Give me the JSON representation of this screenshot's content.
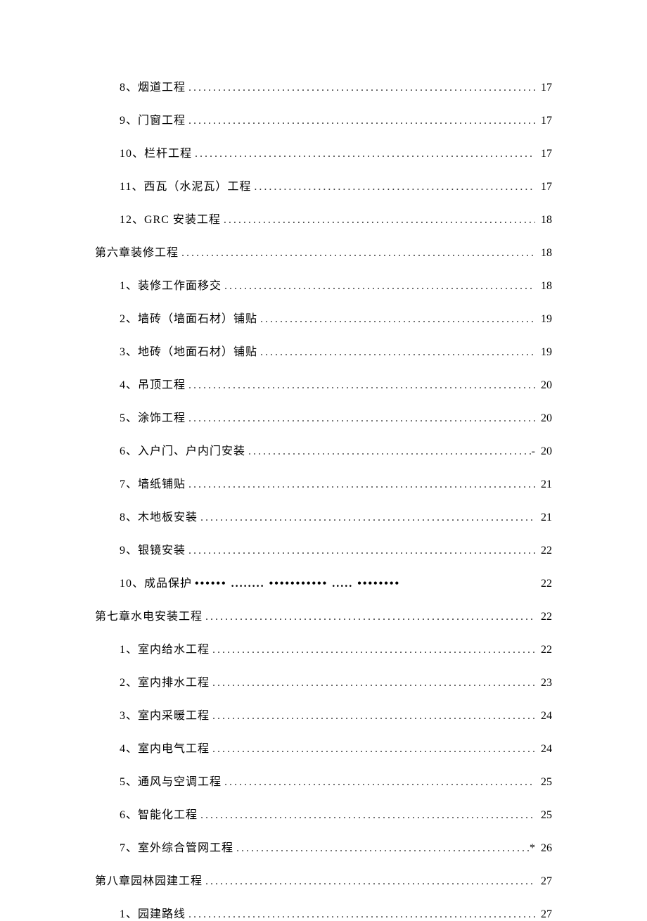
{
  "toc": {
    "entries": [
      {
        "level": 2,
        "label": "8、烟道工程",
        "page": "17",
        "prefix": "",
        "dots": "normal"
      },
      {
        "level": 2,
        "label": "9、门窗工程",
        "page": "17",
        "prefix": "",
        "dots": "normal"
      },
      {
        "level": 2,
        "label": "10、栏杆工程",
        "page": "17",
        "prefix": "",
        "dots": "normal"
      },
      {
        "level": 2,
        "label": "11、西瓦（水泥瓦）工程",
        "page": "17",
        "prefix": "",
        "dots": "normal"
      },
      {
        "level": 2,
        "label": "12、GRC 安装工程",
        "page": "18",
        "prefix": "",
        "dots": "normal"
      },
      {
        "level": 1,
        "label": "第六章装修工程",
        "page": "18",
        "prefix": "",
        "dots": "normal"
      },
      {
        "level": 2,
        "label": "1、装修工作面移交",
        "page": "18",
        "prefix": "",
        "dots": "normal"
      },
      {
        "level": 2,
        "label": "2、墙砖（墙面石材）铺贴",
        "page": "19",
        "prefix": "",
        "dots": "normal"
      },
      {
        "level": 2,
        "label": "3、地砖（地面石材）铺贴",
        "page": "19",
        "prefix": "",
        "dots": "normal"
      },
      {
        "level": 2,
        "label": "4、吊顶工程",
        "page": "20",
        "prefix": "",
        "dots": "normal"
      },
      {
        "level": 2,
        "label": "5、涂饰工程",
        "page": "20",
        "prefix": "",
        "dots": "normal"
      },
      {
        "level": 2,
        "label": "6、入户门、户内门安装",
        "page": "20",
        "prefix": "-",
        "dots": "normal"
      },
      {
        "level": 2,
        "label": "7、墙纸铺贴",
        "page": "21",
        "prefix": "",
        "dots": "normal"
      },
      {
        "level": 2,
        "label": "8、木地板安装",
        "page": "21",
        "prefix": "",
        "dots": "normal"
      },
      {
        "level": 2,
        "label": "9、银镜安装",
        "page": "22",
        "prefix": "",
        "dots": "normal"
      },
      {
        "level": 2,
        "label": "10、成品保护",
        "page": "22",
        "prefix": "",
        "dots": "heavy"
      },
      {
        "level": 1,
        "label": "第七章水电安装工程",
        "page": "22",
        "prefix": "",
        "dots": "normal"
      },
      {
        "level": 2,
        "label": "1、室内给水工程",
        "page": "22",
        "prefix": "",
        "dots": "normal"
      },
      {
        "level": 2,
        "label": "2、室内排水工程",
        "page": "23",
        "prefix": "",
        "dots": "normal"
      },
      {
        "level": 2,
        "label": "3、室内采暖工程",
        "page": "24",
        "prefix": "",
        "dots": "normal"
      },
      {
        "level": 2,
        "label": "4、室内电气工程",
        "page": "24",
        "prefix": "",
        "dots": "normal"
      },
      {
        "level": 2,
        "label": "5、通风与空调工程",
        "page": "25",
        "prefix": "",
        "dots": "normal"
      },
      {
        "level": 2,
        "label": "6、智能化工程",
        "page": "25",
        "prefix": "",
        "dots": "normal"
      },
      {
        "level": 2,
        "label": "7、室外综合管网工程",
        "page": "26",
        "prefix": "*",
        "dots": "normal"
      },
      {
        "level": 1,
        "label": "第八章园林园建工程",
        "page": "27",
        "prefix": "",
        "dots": "normal"
      },
      {
        "level": 2,
        "label": "1、园建路线",
        "page": "27",
        "prefix": "",
        "dots": "normal"
      }
    ],
    "heavy_dots_text": "•••••• ........ ••••••••••• ..... ••••••••   "
  }
}
